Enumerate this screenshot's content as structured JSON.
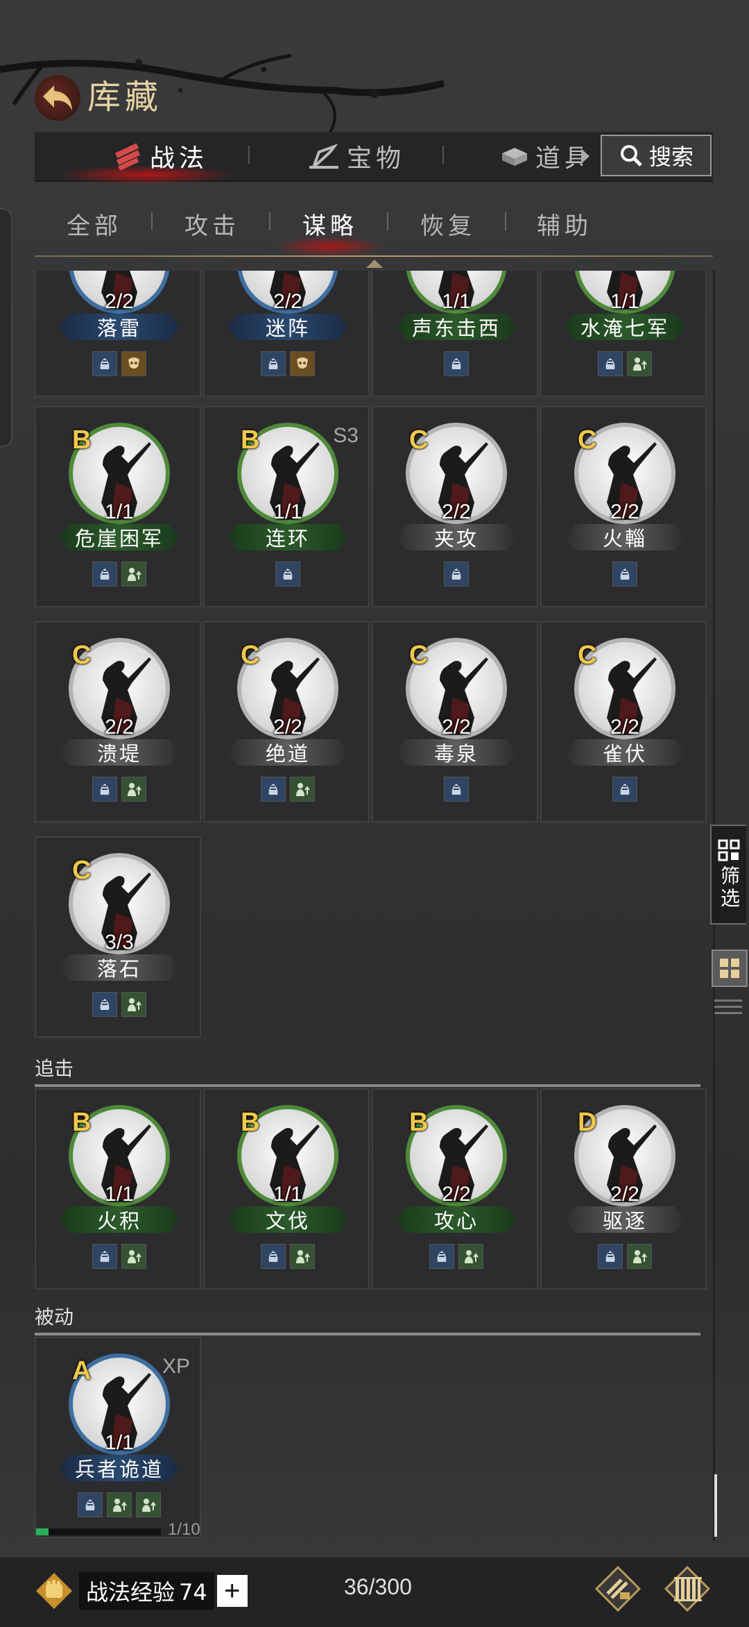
{
  "header": {
    "title": "库藏"
  },
  "main_tabs": [
    {
      "label": "战法",
      "active": true
    },
    {
      "label": "宝物",
      "active": false
    },
    {
      "label": "道具",
      "active": false
    }
  ],
  "search": {
    "label": "搜索"
  },
  "sub_tabs": [
    {
      "label": "全部",
      "active": false
    },
    {
      "label": "攻击",
      "active": false
    },
    {
      "label": "谋略",
      "active": true
    },
    {
      "label": "恢复",
      "active": false
    },
    {
      "label": "辅助",
      "active": false
    }
  ],
  "cards": [
    {
      "name": "落雷",
      "count": "2/2",
      "tier": "blue",
      "tags": [
        "blue",
        "brown"
      ]
    },
    {
      "name": "迷阵",
      "count": "2/2",
      "tier": "blue",
      "tags": [
        "blue",
        "brown"
      ]
    },
    {
      "name": "声东击西",
      "count": "1/1",
      "tier": "green",
      "tags": [
        "blue"
      ]
    },
    {
      "name": "水淹七军",
      "count": "1/1",
      "tier": "green",
      "tags": [
        "blue",
        "green"
      ]
    },
    {
      "name": "危崖困军",
      "grade": "B",
      "count": "1/1",
      "tier": "green",
      "tags": [
        "blue",
        "green"
      ]
    },
    {
      "name": "连环",
      "grade": "B",
      "season": "S3",
      "count": "1/1",
      "tier": "green",
      "tags": [
        "blue"
      ]
    },
    {
      "name": "夹攻",
      "grade": "C",
      "count": "2/2",
      "tier": "grey",
      "tags": [
        "blue"
      ]
    },
    {
      "name": "火輜",
      "grade": "C",
      "count": "2/2",
      "tier": "grey",
      "tags": [
        "blue"
      ]
    },
    {
      "name": "溃堤",
      "grade": "C",
      "count": "2/2",
      "tier": "grey",
      "tags": [
        "blue",
        "green"
      ]
    },
    {
      "name": "绝道",
      "grade": "C",
      "count": "2/2",
      "tier": "grey",
      "tags": [
        "blue",
        "green"
      ]
    },
    {
      "name": "毒泉",
      "grade": "C",
      "count": "2/2",
      "tier": "grey",
      "tags": [
        "blue"
      ]
    },
    {
      "name": "雀伏",
      "grade": "C",
      "count": "2/2",
      "tier": "grey",
      "tags": [
        "blue"
      ]
    },
    {
      "name": "落石",
      "grade": "C",
      "count": "3/3",
      "tier": "grey",
      "tags": [
        "blue",
        "green"
      ]
    }
  ],
  "sections": {
    "pursuit": "追击",
    "passive": "被动"
  },
  "pursuit_cards": [
    {
      "name": "火积",
      "grade": "B",
      "count": "1/1",
      "tier": "green",
      "tags": [
        "blue",
        "green"
      ]
    },
    {
      "name": "文伐",
      "grade": "B",
      "count": "1/1",
      "tier": "green",
      "tags": [
        "blue",
        "green"
      ]
    },
    {
      "name": "攻心",
      "grade": "B",
      "count": "2/2",
      "tier": "green",
      "tags": [
        "blue",
        "green"
      ]
    },
    {
      "name": "驱逐",
      "grade": "D",
      "count": "2/2",
      "tier": "grey",
      "tags": [
        "blue",
        "green"
      ]
    }
  ],
  "passive_cards": [
    {
      "name": "兵者诡道",
      "grade": "A",
      "season": "XP",
      "count": "1/1",
      "tier": "blue",
      "tags": [
        "blue",
        "green",
        "green"
      ],
      "progress_text": "1/10",
      "progress": 0.1
    }
  ],
  "side": {
    "filter_label": "筛选"
  },
  "footer": {
    "exp_label": "战法经验",
    "exp_value": "74",
    "plus": "+",
    "capacity": "36/300"
  }
}
